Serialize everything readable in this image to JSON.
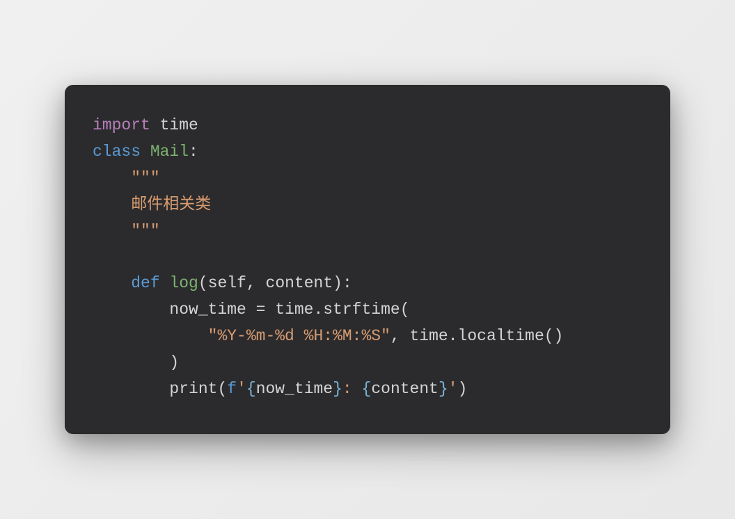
{
  "code": {
    "line1": {
      "import": "import",
      "time": " time"
    },
    "line2": {
      "class": "class",
      "sp": " ",
      "name": "Mail",
      "colon": ":"
    },
    "line3": {
      "indent": "    ",
      "quotes": "\"\"\""
    },
    "line4": {
      "indent": "    ",
      "text": "邮件相关类"
    },
    "line5": {
      "indent": "    ",
      "quotes": "\"\"\""
    },
    "line6": {
      "blank": ""
    },
    "line7": {
      "indent": "    ",
      "def": "def",
      "sp": " ",
      "name": "log",
      "open": "(",
      "p1": "self",
      "comma": ", ",
      "p2": "content",
      "close": "):"
    },
    "line8": {
      "indent": "        ",
      "var": "now_time",
      "eq": " = ",
      "obj": "time",
      "dot": ".",
      "method": "strftime",
      "open": "("
    },
    "line9": {
      "indent": "            ",
      "str": "\"%Y-%m-%d %H:%M:%S\"",
      "comma": ", ",
      "obj": "time",
      "dot": ".",
      "method": "localtime",
      "parens": "()"
    },
    "line10": {
      "indent": "        ",
      "close": ")"
    },
    "line11": {
      "indent": "        ",
      "print": "print",
      "open": "(",
      "fpre": "f",
      "q1": "'",
      "b1o": "{",
      "v1": "now_time",
      "b1c": "}",
      "mid": ": ",
      "b2o": "{",
      "v2": "content",
      "b2c": "}",
      "q2": "'",
      "close": ")"
    }
  }
}
